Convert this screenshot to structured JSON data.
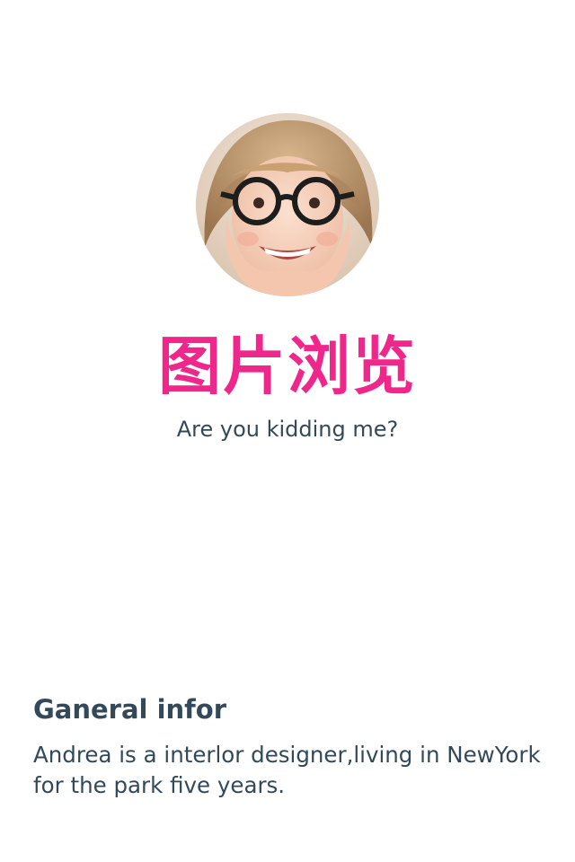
{
  "header": {
    "avatar_icon": "child-with-glasses-photo",
    "title": "图片浏览",
    "subtitle": "Are you kidding me?"
  },
  "general_info": {
    "heading": "Ganeral infor",
    "body": "Andrea is a interlor designer,living in NewYork for the park five years."
  },
  "colors": {
    "title": "#f0278a",
    "text": "#33495a",
    "background": "#ffffff"
  }
}
